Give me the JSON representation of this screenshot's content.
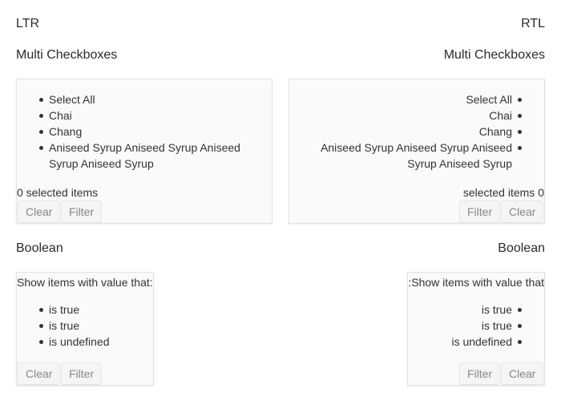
{
  "ltr": {
    "direction_label": "LTR",
    "multi": {
      "title": "Multi Checkboxes",
      "items": [
        "Select All",
        "Chai",
        "Chang",
        "Aniseed Syrup Aniseed Syrup Aniseed Syrup Aniseed Syrup"
      ],
      "selected_info": "0 selected items",
      "clear_label": "Clear",
      "filter_label": "Filter"
    },
    "boolean": {
      "title": "Boolean",
      "prompt": "Show items with value that:",
      "items": [
        "is true",
        "is true",
        "is undefined"
      ],
      "clear_label": "Clear",
      "filter_label": "Filter"
    }
  },
  "rtl": {
    "direction_label": "RTL",
    "multi": {
      "title": "Multi Checkboxes",
      "items": [
        "Select All",
        "Chai",
        "Chang",
        "Aniseed Syrup Aniseed Syrup Aniseed Syrup Aniseed Syrup"
      ],
      "selected_info": "selected items 0",
      "clear_label": "Clear",
      "filter_label": "Filter"
    },
    "boolean": {
      "title": "Boolean",
      "prompt": ":Show items with value that",
      "items": [
        "is true",
        "is true",
        "is undefined"
      ],
      "clear_label": "Clear",
      "filter_label": "Filter"
    }
  }
}
